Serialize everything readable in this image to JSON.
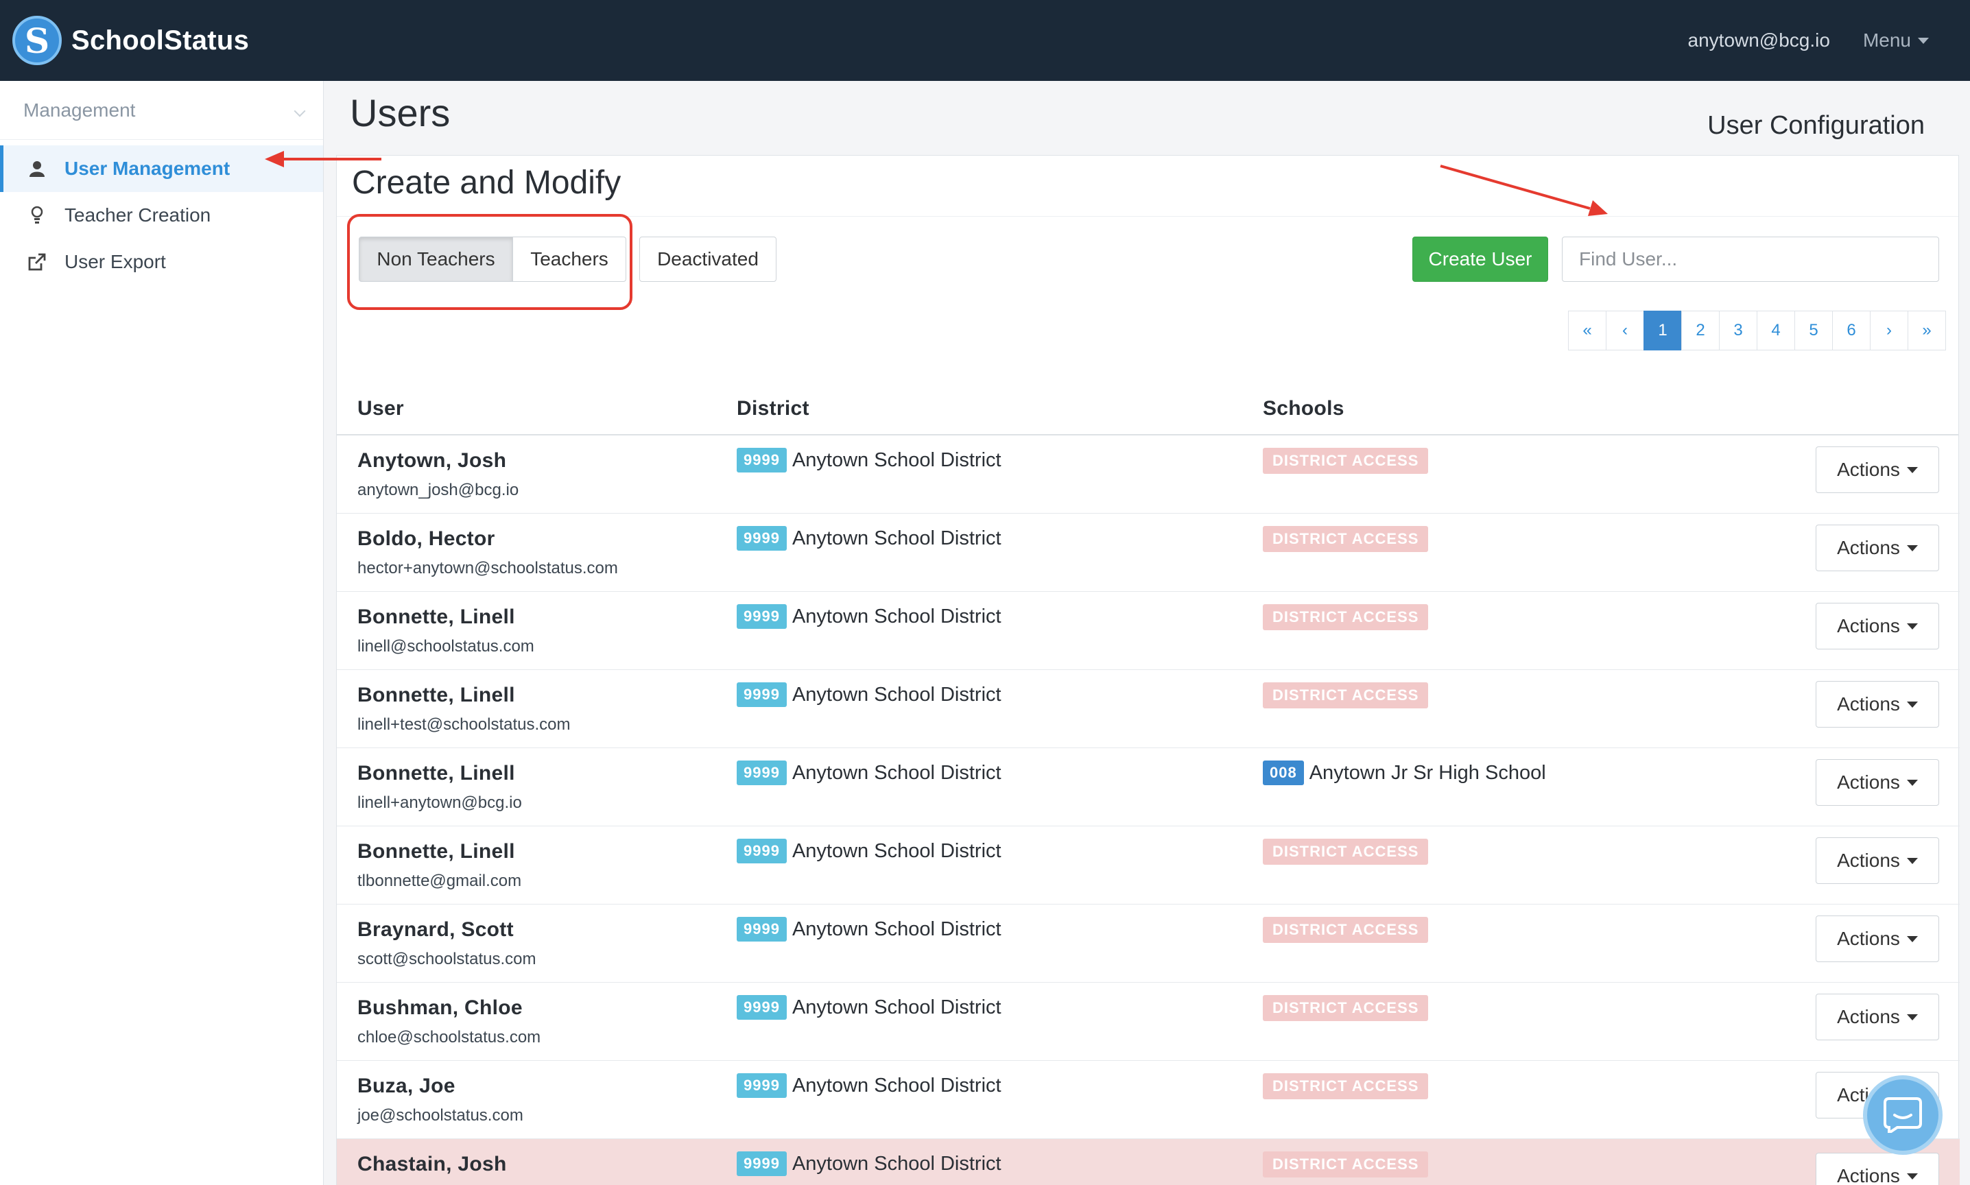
{
  "topbar": {
    "brand": "SchoolStatus",
    "logo_letter": "S",
    "user_email": "anytown@bcg.io",
    "menu_label": "Menu"
  },
  "sidebar": {
    "header": "Management",
    "items": [
      {
        "label": "User Management",
        "icon": "user-icon",
        "active": true
      },
      {
        "label": "Teacher Creation",
        "icon": "lightbulb-icon",
        "active": false
      },
      {
        "label": "User Export",
        "icon": "external-link-icon",
        "active": false
      }
    ]
  },
  "page": {
    "title": "Users",
    "subtitle": "User Configuration"
  },
  "panel": {
    "title": "Create and Modify",
    "filters": [
      "Non Teachers",
      "Teachers",
      "Deactivated"
    ],
    "active_filter": "Non Teachers",
    "create_label": "Create User",
    "search_placeholder": "Find User...",
    "pager": [
      "«",
      "‹",
      "1",
      "2",
      "3",
      "4",
      "5",
      "6",
      "›",
      "»"
    ],
    "current_page": "1"
  },
  "table": {
    "headers": [
      "User",
      "District",
      "Schools"
    ],
    "action_label": "Actions",
    "rows": [
      {
        "name": "Anytown, Josh",
        "email": "anytown_josh@bcg.io",
        "district_code": "9999",
        "district": "Anytown School District",
        "school_badge": "DISTRICT ACCESS",
        "school": ""
      },
      {
        "name": "Boldo, Hector",
        "email": "hector+anytown@schoolstatus.com",
        "district_code": "9999",
        "district": "Anytown School District",
        "school_badge": "DISTRICT ACCESS",
        "school": ""
      },
      {
        "name": "Bonnette, Linell",
        "email": "linell@schoolstatus.com",
        "district_code": "9999",
        "district": "Anytown School District",
        "school_badge": "DISTRICT ACCESS",
        "school": ""
      },
      {
        "name": "Bonnette, Linell",
        "email": "linell+test@schoolstatus.com",
        "district_code": "9999",
        "district": "Anytown School District",
        "school_badge": "DISTRICT ACCESS",
        "school": ""
      },
      {
        "name": "Bonnette, Linell",
        "email": "linell+anytown@bcg.io",
        "district_code": "9999",
        "district": "Anytown School District",
        "school_badge": "008",
        "school": "Anytown Jr Sr High School"
      },
      {
        "name": "Bonnette, Linell",
        "email": "tlbonnette@gmail.com",
        "district_code": "9999",
        "district": "Anytown School District",
        "school_badge": "DISTRICT ACCESS",
        "school": ""
      },
      {
        "name": "Braynard, Scott",
        "email": "scott@schoolstatus.com",
        "district_code": "9999",
        "district": "Anytown School District",
        "school_badge": "DISTRICT ACCESS",
        "school": ""
      },
      {
        "name": "Bushman, Chloe",
        "email": "chloe@schoolstatus.com",
        "district_code": "9999",
        "district": "Anytown School District",
        "school_badge": "DISTRICT ACCESS",
        "school": ""
      },
      {
        "name": "Buza, Joe",
        "email": "joe@schoolstatus.com",
        "district_code": "9999",
        "district": "Anytown School District",
        "school_badge": "DISTRICT ACCESS",
        "school": ""
      },
      {
        "name": "Chastain, Josh",
        "email": "",
        "district_code": "9999",
        "district": "Anytown School District",
        "school_badge": "DISTRICT ACCESS",
        "school": ""
      }
    ]
  },
  "colors": {
    "navbar": "#1b2938",
    "accent": "#2f8ed8",
    "create_button": "#3faf4e",
    "district_badge": "#5bc0de",
    "access_badge": "#f2c9c9",
    "annotation": "#e53a2f",
    "highlight_row": "#f4dcdc"
  }
}
